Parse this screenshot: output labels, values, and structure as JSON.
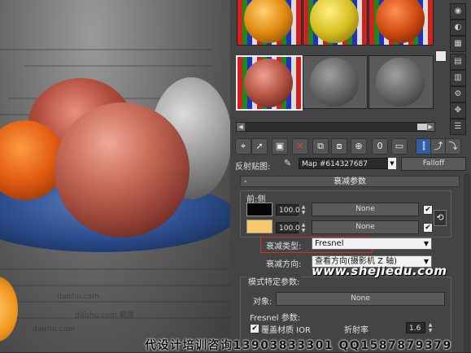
{
  "viewport": {
    "news_text": [
      "daishu.com",
      "daishu.com 截图",
      "daishu.com"
    ]
  },
  "material_editor": {
    "reflection_map_label": "反射贴图:",
    "map_name": "Map #614327687",
    "map_type_button": "Falloff",
    "rollout_title": "衰减参数",
    "front_side_label": "前:侧",
    "slot1_value": "100.0",
    "slot1_map": "None",
    "slot2_value": "100.0",
    "slot2_map": "None",
    "falloff_type_label": "衰减类型:",
    "falloff_type_value": "Fresnel",
    "falloff_direction_label": "衰减方向:",
    "falloff_direction_value": "查看方向(摄影机 Z 轴)",
    "mode_specific_label": "模式特定参数:",
    "object_label": "对象:",
    "object_value": "None",
    "fresnel_params_label": "Fresnel 参数:",
    "override_ior_label": "覆盖材质 IOR",
    "ior_label": "折射率",
    "ior_value": "1.6",
    "minimize_symbol": "-"
  },
  "watermarks": {
    "url": "www.shejiedu.com",
    "contact": "代设计培训咨询13903833301 QQ1587879379"
  },
  "colors": {
    "swatch_black": "#050505",
    "swatch_orange": "#f6c86a",
    "highlight_box": "#d03030"
  }
}
